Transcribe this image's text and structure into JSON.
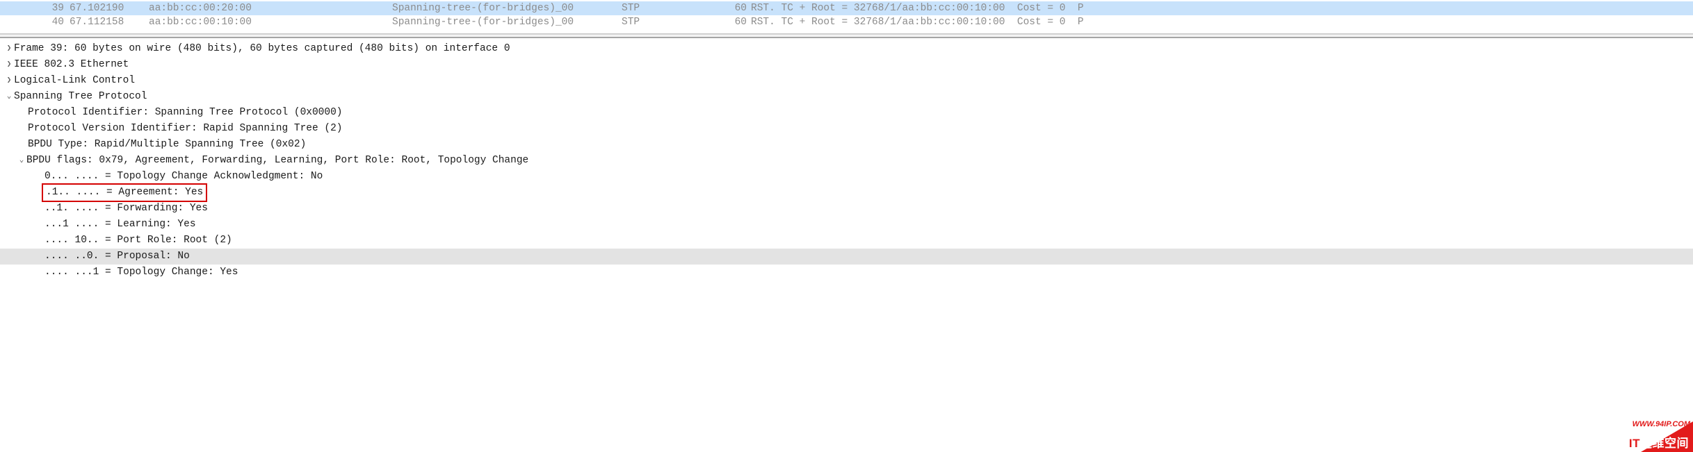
{
  "packets": [
    {
      "no": "39",
      "time": "67.102190",
      "src": "aa:bb:cc:00:20:00",
      "dst": "Spanning-tree-(for-bridges)_00",
      "proto": "STP",
      "len": "60",
      "info": "RST. TC + Root = 32768/1/aa:bb:cc:00:10:00  Cost = 0  P",
      "selected": true
    },
    {
      "no": "40",
      "time": "67.112158",
      "src": "aa:bb:cc:00:10:00",
      "dst": "Spanning-tree-(for-bridges)_00",
      "proto": "STP",
      "len": "60",
      "info": "RST. TC + Root = 32768/1/aa:bb:cc:00:10:00  Cost = 0  P",
      "selected": false
    }
  ],
  "details": {
    "frame": "Frame 39: 60 bytes on wire (480 bits), 60 bytes captured (480 bits) on interface 0",
    "eth": "IEEE 802.3 Ethernet",
    "llc": "Logical-Link Control",
    "stp": "Spanning Tree Protocol",
    "proto_id": "Protocol Identifier: Spanning Tree Protocol (0x0000)",
    "proto_ver": "Protocol Version Identifier: Rapid Spanning Tree (2)",
    "bpdu_type": "BPDU Type: Rapid/Multiple Spanning Tree (0x02)",
    "flags": "BPDU flags: 0x79, Agreement, Forwarding, Learning, Port Role: Root, Topology Change",
    "flag_tca": "0... .... = Topology Change Acknowledgment: No",
    "flag_agree": ".1.. .... = Agreement: Yes",
    "flag_forward": "..1. .... = Forwarding: Yes",
    "flag_learn": "...1 .... = Learning: Yes",
    "flag_role": ".... 10.. = Port Role: Root (2)",
    "flag_proposal": ".... ..0. = Proposal: No",
    "flag_tc": ".... ...1 = Topology Change: Yes"
  },
  "watermark": {
    "url": "WWW.94IP.COM",
    "main_red": "IT",
    "main_white": "运维空间"
  }
}
